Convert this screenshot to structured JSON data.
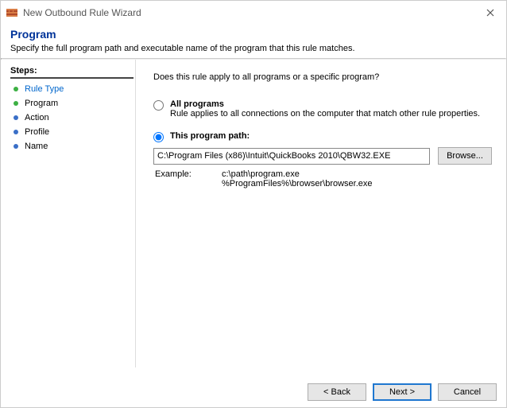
{
  "titlebar": {
    "title": "New Outbound Rule Wizard"
  },
  "header": {
    "title": "Program",
    "subtitle": "Specify the full program path and executable name of the program that this rule matches."
  },
  "steps": {
    "label": "Steps:",
    "items": [
      {
        "label": "Rule Type",
        "state": "done-link"
      },
      {
        "label": "Program",
        "state": "current"
      },
      {
        "label": "Action",
        "state": "pending"
      },
      {
        "label": "Profile",
        "state": "pending"
      },
      {
        "label": "Name",
        "state": "pending"
      }
    ]
  },
  "content": {
    "question": "Does this rule apply to all programs or a specific program?",
    "opt_all": {
      "title": "All programs",
      "desc": "Rule applies to all connections on the computer that match other rule properties."
    },
    "opt_path": {
      "title": "This program path:",
      "value": "C:\\Program Files (x86)\\Intuit\\QuickBooks 2010\\QBW32.EXE",
      "browse": "Browse...",
      "example_label": "Example:",
      "example_lines": "c:\\path\\program.exe\n%ProgramFiles%\\browser\\browser.exe"
    }
  },
  "buttons": {
    "back": "< Back",
    "next": "Next >",
    "cancel": "Cancel"
  }
}
